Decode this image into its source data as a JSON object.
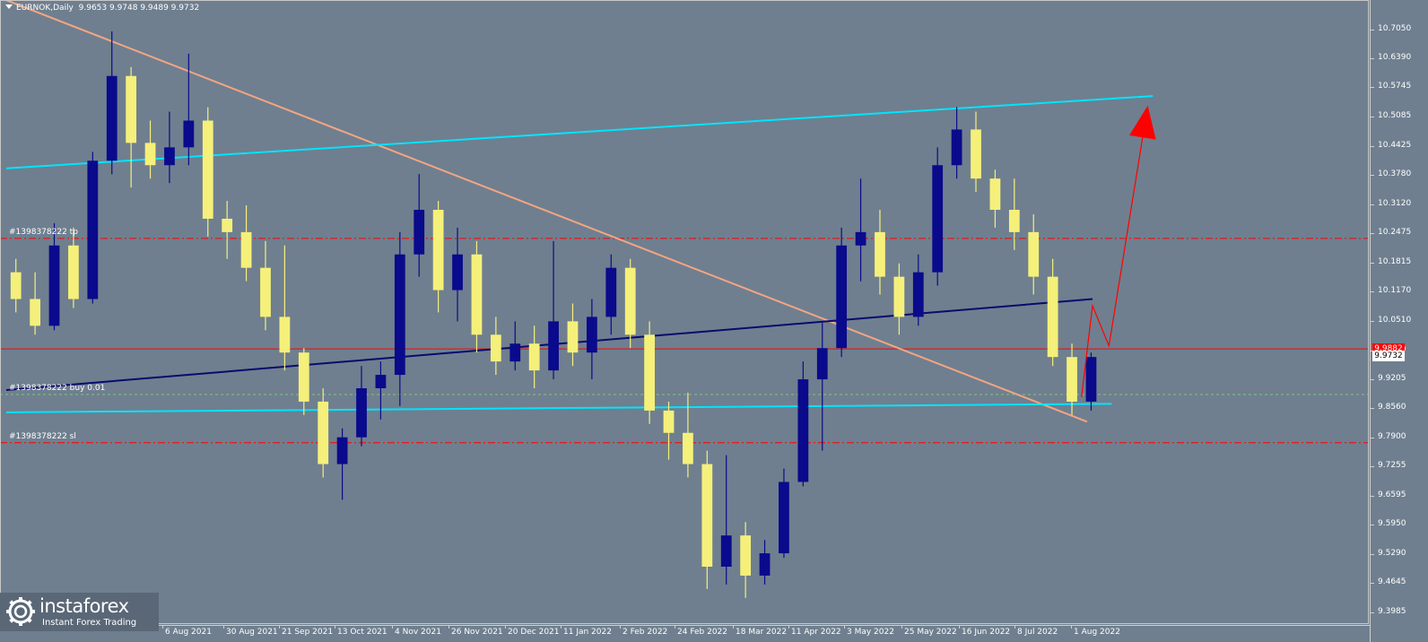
{
  "header": {
    "symbol": "EURNOK,Daily",
    "ohlc": "9.9653 9.9748 9.9489 9.9732"
  },
  "colors": {
    "background": "#6f7f8f",
    "bull_candle": "#0a0a8c",
    "bear_candle": "#f5f07a",
    "downtrend_line": "#f4a582",
    "channel_line": "#00e5ff",
    "mid_line": "#0a0a6e",
    "level_red": "#ff0000",
    "buy_level": "#7fc67f",
    "forecast": "#ff0000"
  },
  "orders": {
    "tp_label": "#1398378222 tp",
    "buy_label": "#1398378222 buy 0.01",
    "sl_label": "#1398378222 sl"
  },
  "price_boxes": {
    "red_level": "9.9882",
    "current": "9.9732"
  },
  "logo": {
    "name": "instaforex",
    "tagline": "Instant Forex Trading",
    "icon": "instaforex-logo-icon"
  },
  "chart_data": {
    "type": "candlestick",
    "symbol": "EURNOK",
    "timeframe": "Daily",
    "y_ticks": [
      "10.7050",
      "10.6390",
      "10.5745",
      "10.5085",
      "10.4425",
      "10.3780",
      "10.3120",
      "10.2475",
      "10.1815",
      "10.1170",
      "10.0510",
      "9.9850",
      "9.9205",
      "9.8560",
      "9.7900",
      "9.7255",
      "9.6595",
      "9.5950",
      "9.5290",
      "9.4645",
      "9.3985"
    ],
    "ylim": [
      9.3985,
      10.705
    ],
    "x_ticks": [
      "6 Aug 2021",
      "30 Aug 2021",
      "21 Sep 2021",
      "13 Oct 2021",
      "4 Nov 2021",
      "26 Nov 2021",
      "20 Dec 2021",
      "11 Jan 2022",
      "2 Feb 2022",
      "24 Feb 2022",
      "18 Mar 2022",
      "11 Apr 2022",
      "3 May 2022",
      "25 May 2022",
      "16 Jun 2022",
      "8 Jul 2022",
      "1 Aug 2022"
    ],
    "levels": [
      {
        "name": "take-profit",
        "price": 10.236,
        "style": "dash-dot",
        "color": "#ff0000"
      },
      {
        "name": "current-red",
        "price": 9.9882,
        "style": "solid",
        "color": "#ff0000"
      },
      {
        "name": "buy-entry",
        "price": 9.886,
        "style": "dashed",
        "color": "#7fc67f"
      },
      {
        "name": "stop-loss",
        "price": 9.778,
        "style": "dash-dot",
        "color": "#ff0000"
      }
    ],
    "trend_lines": [
      {
        "name": "downtrend-line",
        "from": {
          "x": "2021-07-05",
          "y": 10.77
        },
        "to": {
          "x": "2022-08-03",
          "y": 9.825
        },
        "color": "#f4a582"
      },
      {
        "name": "upper-channel",
        "from": {
          "x": "2021-07-05",
          "y": 10.393
        },
        "to": {
          "x": "2022-08-27",
          "y": 10.555
        },
        "color": "#00e5ff"
      },
      {
        "name": "lower-channel",
        "from": {
          "x": "2021-07-05",
          "y": 9.846
        },
        "to": {
          "x": "2022-08-12",
          "y": 9.865
        },
        "color": "#00e5ff"
      },
      {
        "name": "mid-line",
        "from": {
          "x": "2021-07-05",
          "y": 9.896
        },
        "to": {
          "x": "2022-08-05",
          "y": 10.1
        },
        "color": "#0a0a6e"
      }
    ],
    "forecast_path": [
      {
        "x": "2022-08-01",
        "y": 9.88
      },
      {
        "x": "2022-08-05",
        "y": 10.085
      },
      {
        "x": "2022-08-11",
        "y": 9.995
      },
      {
        "x": "2022-08-24",
        "y": 10.49
      }
    ],
    "candles": [
      {
        "x": "2021-07-05",
        "o": 10.16,
        "h": 10.19,
        "l": 10.07,
        "c": 10.1
      },
      {
        "x": "2021-07-12",
        "o": 10.1,
        "h": 10.16,
        "l": 10.02,
        "c": 10.04
      },
      {
        "x": "2021-07-19",
        "o": 10.04,
        "h": 10.27,
        "l": 10.03,
        "c": 10.22
      },
      {
        "x": "2021-07-26",
        "o": 10.22,
        "h": 10.26,
        "l": 10.08,
        "c": 10.1
      },
      {
        "x": "2021-08-02",
        "o": 10.1,
        "h": 10.43,
        "l": 10.09,
        "c": 10.41
      },
      {
        "x": "2021-08-09",
        "o": 10.41,
        "h": 10.7,
        "l": 10.38,
        "c": 10.6
      },
      {
        "x": "2021-08-16",
        "o": 10.6,
        "h": 10.62,
        "l": 10.35,
        "c": 10.45
      },
      {
        "x": "2021-08-23",
        "o": 10.45,
        "h": 10.5,
        "l": 10.37,
        "c": 10.4
      },
      {
        "x": "2021-08-30",
        "o": 10.4,
        "h": 10.52,
        "l": 10.36,
        "c": 10.44
      },
      {
        "x": "2021-09-06",
        "o": 10.44,
        "h": 10.65,
        "l": 10.4,
        "c": 10.5
      },
      {
        "x": "2021-09-13",
        "o": 10.5,
        "h": 10.53,
        "l": 10.24,
        "c": 10.28
      },
      {
        "x": "2021-09-20",
        "o": 10.28,
        "h": 10.32,
        "l": 10.19,
        "c": 10.25
      },
      {
        "x": "2021-09-27",
        "o": 10.25,
        "h": 10.31,
        "l": 10.14,
        "c": 10.17
      },
      {
        "x": "2021-10-04",
        "o": 10.17,
        "h": 10.23,
        "l": 10.03,
        "c": 10.06
      },
      {
        "x": "2021-10-11",
        "o": 10.06,
        "h": 10.22,
        "l": 9.94,
        "c": 9.98
      },
      {
        "x": "2021-10-18",
        "o": 9.98,
        "h": 9.99,
        "l": 9.84,
        "c": 9.87
      },
      {
        "x": "2021-10-25",
        "o": 9.87,
        "h": 9.9,
        "l": 9.7,
        "c": 9.73
      },
      {
        "x": "2021-11-01",
        "o": 9.73,
        "h": 9.81,
        "l": 9.65,
        "c": 9.79
      },
      {
        "x": "2021-11-08",
        "o": 9.79,
        "h": 9.95,
        "l": 9.77,
        "c": 9.9
      },
      {
        "x": "2021-11-15",
        "o": 9.9,
        "h": 9.96,
        "l": 9.83,
        "c": 9.93
      },
      {
        "x": "2021-11-22",
        "o": 9.93,
        "h": 10.25,
        "l": 9.86,
        "c": 10.2
      },
      {
        "x": "2021-11-29",
        "o": 10.2,
        "h": 10.38,
        "l": 10.15,
        "c": 10.3
      },
      {
        "x": "2021-12-06",
        "o": 10.3,
        "h": 10.32,
        "l": 10.07,
        "c": 10.12
      },
      {
        "x": "2021-12-13",
        "o": 10.12,
        "h": 10.26,
        "l": 10.05,
        "c": 10.2
      },
      {
        "x": "2021-12-20",
        "o": 10.2,
        "h": 10.23,
        "l": 9.98,
        "c": 10.02
      },
      {
        "x": "2021-12-27",
        "o": 10.02,
        "h": 10.06,
        "l": 9.93,
        "c": 9.96
      },
      {
        "x": "2022-01-03",
        "o": 9.96,
        "h": 10.05,
        "l": 9.94,
        "c": 10.0
      },
      {
        "x": "2022-01-10",
        "o": 10.0,
        "h": 10.04,
        "l": 9.9,
        "c": 9.94
      },
      {
        "x": "2022-01-17",
        "o": 9.94,
        "h": 10.23,
        "l": 9.92,
        "c": 10.05
      },
      {
        "x": "2022-01-24",
        "o": 10.05,
        "h": 10.09,
        "l": 9.95,
        "c": 9.98
      },
      {
        "x": "2022-01-31",
        "o": 9.98,
        "h": 10.1,
        "l": 9.92,
        "c": 10.06
      },
      {
        "x": "2022-02-07",
        "o": 10.06,
        "h": 10.2,
        "l": 10.02,
        "c": 10.17
      },
      {
        "x": "2022-02-14",
        "o": 10.17,
        "h": 10.19,
        "l": 9.99,
        "c": 10.02
      },
      {
        "x": "2022-02-21",
        "o": 10.02,
        "h": 10.05,
        "l": 9.82,
        "c": 9.85
      },
      {
        "x": "2022-02-28",
        "o": 9.85,
        "h": 9.87,
        "l": 9.74,
        "c": 9.8
      },
      {
        "x": "2022-03-07",
        "o": 9.8,
        "h": 9.89,
        "l": 9.7,
        "c": 9.73
      },
      {
        "x": "2022-03-14",
        "o": 9.73,
        "h": 9.76,
        "l": 9.45,
        "c": 9.5
      },
      {
        "x": "2022-03-21",
        "o": 9.5,
        "h": 9.75,
        "l": 9.46,
        "c": 9.57
      },
      {
        "x": "2022-03-28",
        "o": 9.57,
        "h": 9.6,
        "l": 9.43,
        "c": 9.48
      },
      {
        "x": "2022-04-04",
        "o": 9.48,
        "h": 9.56,
        "l": 9.46,
        "c": 9.53
      },
      {
        "x": "2022-04-11",
        "o": 9.53,
        "h": 9.72,
        "l": 9.52,
        "c": 9.69
      },
      {
        "x": "2022-04-18",
        "o": 9.69,
        "h": 9.96,
        "l": 9.68,
        "c": 9.92
      },
      {
        "x": "2022-04-25",
        "o": 9.92,
        "h": 10.05,
        "l": 9.76,
        "c": 9.99
      },
      {
        "x": "2022-05-02",
        "o": 9.99,
        "h": 10.26,
        "l": 9.97,
        "c": 10.22
      },
      {
        "x": "2022-05-09",
        "o": 10.22,
        "h": 10.37,
        "l": 10.14,
        "c": 10.25
      },
      {
        "x": "2022-05-16",
        "o": 10.25,
        "h": 10.3,
        "l": 10.11,
        "c": 10.15
      },
      {
        "x": "2022-05-23",
        "o": 10.15,
        "h": 10.18,
        "l": 10.02,
        "c": 10.06
      },
      {
        "x": "2022-05-30",
        "o": 10.06,
        "h": 10.2,
        "l": 10.04,
        "c": 10.16
      },
      {
        "x": "2022-06-06",
        "o": 10.16,
        "h": 10.44,
        "l": 10.13,
        "c": 10.4
      },
      {
        "x": "2022-06-13",
        "o": 10.4,
        "h": 10.53,
        "l": 10.37,
        "c": 10.48
      },
      {
        "x": "2022-06-20",
        "o": 10.48,
        "h": 10.52,
        "l": 10.34,
        "c": 10.37
      },
      {
        "x": "2022-06-27",
        "o": 10.37,
        "h": 10.39,
        "l": 10.26,
        "c": 10.3
      },
      {
        "x": "2022-07-04",
        "o": 10.3,
        "h": 10.37,
        "l": 10.21,
        "c": 10.25
      },
      {
        "x": "2022-07-11",
        "o": 10.25,
        "h": 10.29,
        "l": 10.11,
        "c": 10.15
      },
      {
        "x": "2022-07-18",
        "o": 10.15,
        "h": 10.19,
        "l": 9.95,
        "c": 9.97
      },
      {
        "x": "2022-07-25",
        "o": 9.97,
        "h": 10.0,
        "l": 9.84,
        "c": 9.87
      },
      {
        "x": "2022-08-01",
        "o": 9.87,
        "h": 9.98,
        "l": 9.85,
        "c": 9.97
      }
    ]
  }
}
